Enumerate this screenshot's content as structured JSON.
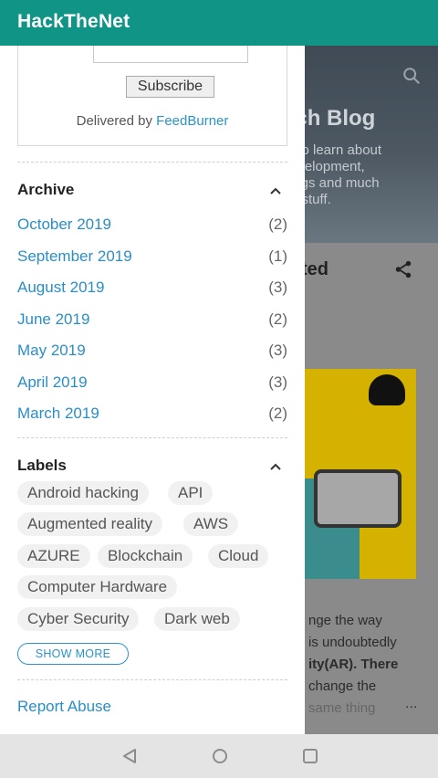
{
  "app": {
    "title": "HackTheNet"
  },
  "background": {
    "blog_title": "ech Blog",
    "blog_desc_lines": [
      "t to learn about",
      "evelopment,",
      "ings and much",
      "d stuff."
    ],
    "card_title": "ted",
    "text_lines": [
      "nge the way",
      "is undoubtedly",
      "ity(AR). There",
      "change the",
      "same thing"
    ],
    "ellipsis": "..."
  },
  "feedburner": {
    "subscribe_label": "Subscribe",
    "delivered_prefix": "Delivered by ",
    "delivered_link": "FeedBurner"
  },
  "archive": {
    "title": "Archive",
    "items": [
      {
        "label": "October 2019",
        "count": "(2)"
      },
      {
        "label": "September 2019",
        "count": "(1)"
      },
      {
        "label": "August 2019",
        "count": "(3)"
      },
      {
        "label": "June 2019",
        "count": "(2)"
      },
      {
        "label": "May 2019",
        "count": "(3)"
      },
      {
        "label": "April 2019",
        "count": "(3)"
      },
      {
        "label": "March 2019",
        "count": "(2)"
      }
    ]
  },
  "labels": {
    "title": "Labels",
    "chips": [
      "Android hacking",
      "API",
      "Augmented reality",
      "AWS",
      "AZURE",
      "Blockchain",
      "Cloud",
      "Computer Hardware",
      "Cyber Security",
      "Dark web"
    ],
    "show_more": "SHOW MORE"
  },
  "footer": {
    "report_abuse": "Report Abuse"
  },
  "colors": {
    "appbar": "#0f9485",
    "link": "#2a8ec6"
  },
  "icons": [
    "search-icon",
    "share-icon",
    "chevron-up-icon",
    "nav-back-icon",
    "nav-home-icon",
    "nav-recent-icon"
  ]
}
